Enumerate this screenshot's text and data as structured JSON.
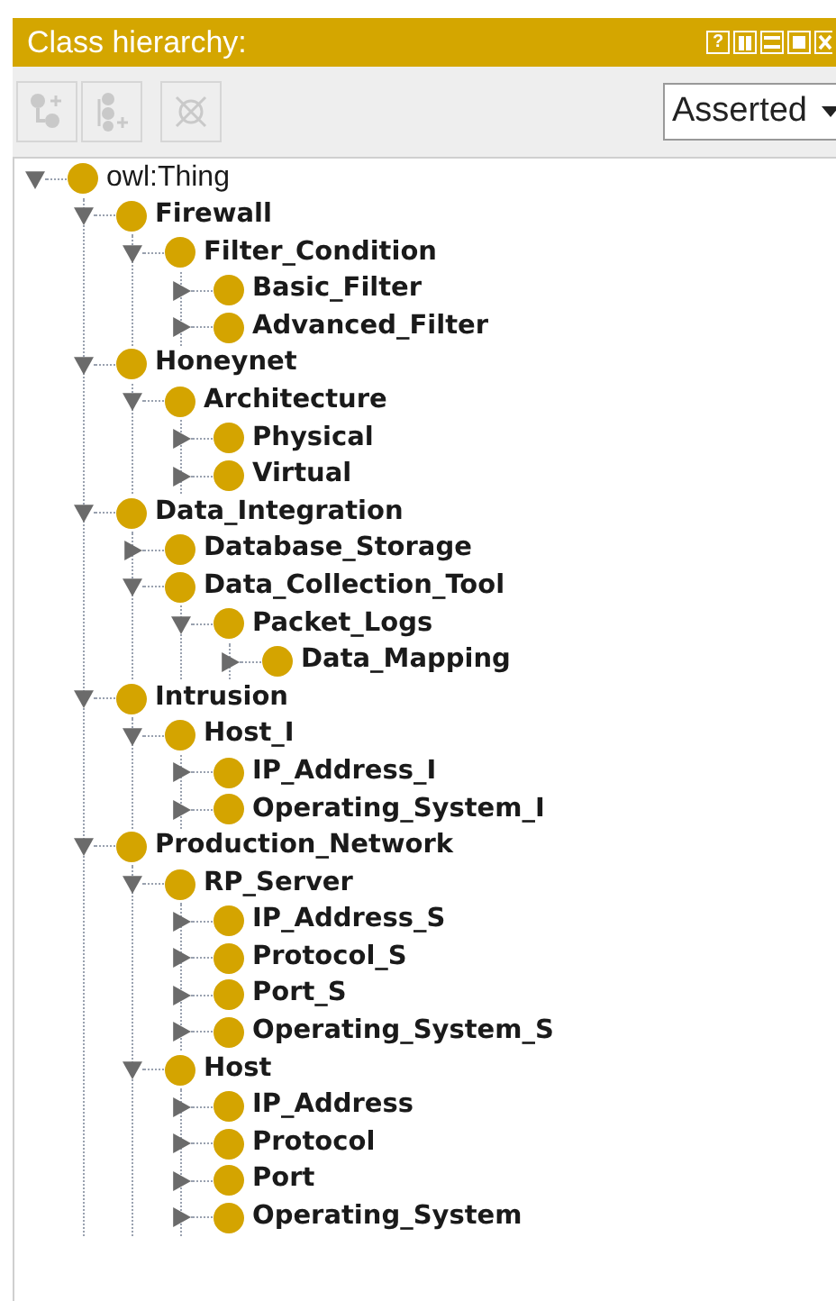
{
  "header": {
    "title": "Class hierarchy:",
    "buttons": [
      "?"
    ]
  },
  "toolbar": {
    "buttons": [
      {
        "kind": "add-subclass",
        "disabled": true
      },
      {
        "kind": "add-sibling",
        "disabled": true
      },
      {
        "kind": "delete",
        "disabled": true
      }
    ],
    "dropdown": {
      "value": "Asserted"
    }
  },
  "tree": {
    "label": "owl:Thing",
    "expanded": true,
    "children": [
      {
        "label": "Firewall",
        "expanded": true,
        "children": [
          {
            "label": "Filter_Condition",
            "expanded": true,
            "children": [
              {
                "label": "Basic_Filter",
                "expanded": false
              },
              {
                "label": "Advanced_Filter",
                "expanded": false
              }
            ]
          }
        ]
      },
      {
        "label": "Honeynet",
        "expanded": true,
        "children": [
          {
            "label": "Architecture",
            "expanded": true,
            "children": [
              {
                "label": "Physical",
                "expanded": false
              },
              {
                "label": "Virtual",
                "expanded": false
              }
            ]
          }
        ]
      },
      {
        "label": "Data_Integration",
        "expanded": true,
        "children": [
          {
            "label": "Database_Storage",
            "expanded": false
          },
          {
            "label": "Data_Collection_Tool",
            "expanded": true,
            "children": [
              {
                "label": "Packet_Logs",
                "expanded": true,
                "children": [
                  {
                    "label": "Data_Mapping",
                    "expanded": false
                  }
                ]
              }
            ]
          }
        ]
      },
      {
        "label": "Intrusion",
        "expanded": true,
        "children": [
          {
            "label": "Host_I",
            "expanded": true,
            "children": [
              {
                "label": "IP_Address_I",
                "expanded": false
              },
              {
                "label": "Operating_System_I",
                "expanded": false
              }
            ]
          }
        ]
      },
      {
        "label": "Production_Network",
        "expanded": true,
        "children": [
          {
            "label": "RP_Server",
            "expanded": true,
            "children": [
              {
                "label": "IP_Address_S",
                "expanded": false
              },
              {
                "label": "Protocol_S",
                "expanded": false
              },
              {
                "label": "Port_S",
                "expanded": false
              },
              {
                "label": "Operating_System_S",
                "expanded": false
              }
            ]
          },
          {
            "label": "Host",
            "expanded": true,
            "children": [
              {
                "label": "IP_Address",
                "expanded": false
              },
              {
                "label": "Protocol",
                "expanded": false
              },
              {
                "label": "Port",
                "expanded": false
              },
              {
                "label": "Operating_System",
                "expanded": false
              }
            ]
          }
        ]
      }
    ]
  }
}
